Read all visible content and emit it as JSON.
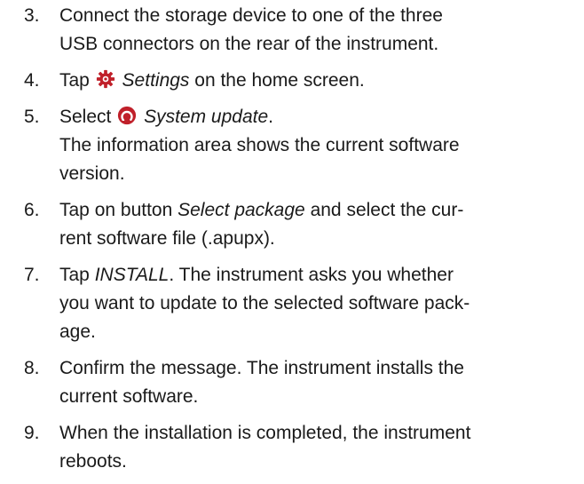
{
  "steps": [
    {
      "number": "3.",
      "lines": [
        "Connect the storage device to one of the three",
        "USB connectors on the rear of the instrument."
      ]
    },
    {
      "number": "4.",
      "pre": "Tap",
      "icon": "settings-gear-icon",
      "italic": "Settings",
      "post": "on the home screen."
    },
    {
      "number": "5.",
      "pre": "Select",
      "icon": "system-update-icon",
      "italic": "System update",
      "post": ".",
      "lines": [
        "The information area shows the current software",
        "version."
      ]
    },
    {
      "number": "6.",
      "pre": "Tap on button",
      "italic": "Select package",
      "post": "and select the cur-",
      "lines": [
        "rent software file (.apupx)."
      ]
    },
    {
      "number": "7.",
      "pre": "Tap",
      "italic": "INSTALL",
      "post": ". The instrument asks you whether",
      "lines": [
        "you want to update to the selected software pack-",
        "age."
      ]
    },
    {
      "number": "8.",
      "lines": [
        "Confirm the message. The instrument installs the",
        "current software."
      ]
    },
    {
      "number": "9.",
      "lines": [
        "When the installation is completed, the instrument",
        "reboots."
      ]
    }
  ],
  "colors": {
    "icon_red": "#c0202a",
    "text": "#1a1a1a"
  }
}
